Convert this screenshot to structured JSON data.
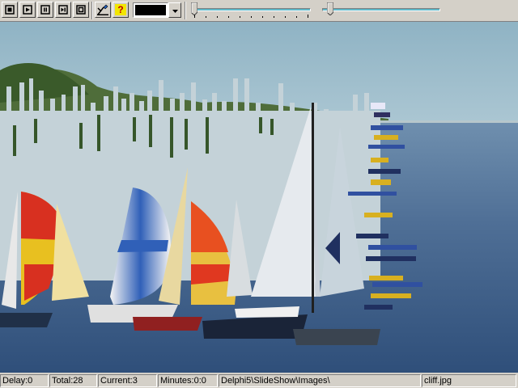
{
  "toolbar": {
    "buttons": [
      {
        "name": "stop-icon"
      },
      {
        "name": "play-icon"
      },
      {
        "name": "pause-icon"
      },
      {
        "name": "step-icon"
      },
      {
        "name": "fullscreen-icon"
      },
      {
        "name": "settings-icon"
      },
      {
        "name": "help-icon"
      }
    ],
    "help_glyph": "?",
    "color_value": "#000000"
  },
  "status": {
    "delay": "Delay:0",
    "total": "Total:28",
    "current": "Current:3",
    "minutes": "Minutes:0:0",
    "path": "Delphi5\\SlideShow\\Images\\",
    "file": "cliff.jpg"
  },
  "colors": {
    "window_bg": "#d4d0c8",
    "track_fill": "#5fb8c8"
  }
}
